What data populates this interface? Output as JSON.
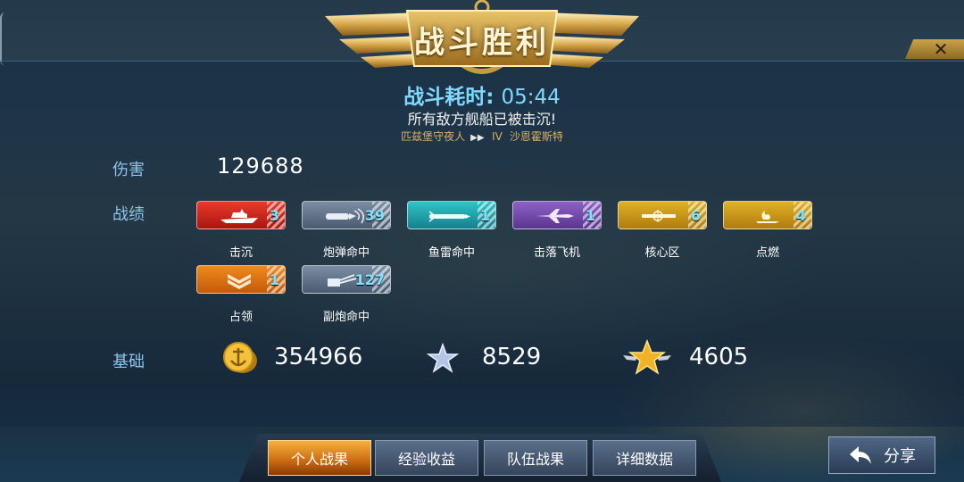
{
  "header": {
    "title": "战斗胜利",
    "close_symbol": "✕"
  },
  "battle": {
    "time_label": "战斗耗时:",
    "time_value": "05:44",
    "result_text": "所有敌方舰船已被击沉!",
    "player_ship": "匹兹堡守夜人",
    "enemy_tier": "IV",
    "enemy_ship": "沙恩霍斯特"
  },
  "damage": {
    "label": "伤害",
    "value": "129688"
  },
  "achievements": {
    "label": "战绩",
    "items": [
      {
        "name": "击沉",
        "count": "3",
        "color": "#d42a1c",
        "icon": "warship-icon"
      },
      {
        "name": "炮弹命中",
        "count": "39",
        "color": "#5e6f86",
        "icon": "shell-icon"
      },
      {
        "name": "鱼雷命中",
        "count": "1",
        "color": "#21a2aa",
        "icon": "torpedo-icon"
      },
      {
        "name": "击落飞机",
        "count": "1",
        "color": "#7248a8",
        "icon": "plane-icon"
      },
      {
        "name": "核心区",
        "count": "6",
        "color": "#c8961a",
        "icon": "citadel-icon"
      },
      {
        "name": "点燃",
        "count": "4",
        "color": "#c8961a",
        "icon": "fire-icon"
      },
      {
        "name": "占领",
        "count": "1",
        "color": "#e27216",
        "icon": "capture-chevron-icon"
      },
      {
        "name": "副炮命中",
        "count": "127",
        "color": "#5e6f86",
        "icon": "secondary-gun-icon"
      }
    ]
  },
  "base": {
    "label": "基础",
    "coins": "354966",
    "exp": "8529",
    "captain_exp": "4605"
  },
  "tabs": [
    {
      "label": "个人战果",
      "active": true
    },
    {
      "label": "经验收益",
      "active": false
    },
    {
      "label": "队伍战果",
      "active": false
    },
    {
      "label": "详细数据",
      "active": false
    }
  ],
  "share": {
    "label": "分享"
  }
}
